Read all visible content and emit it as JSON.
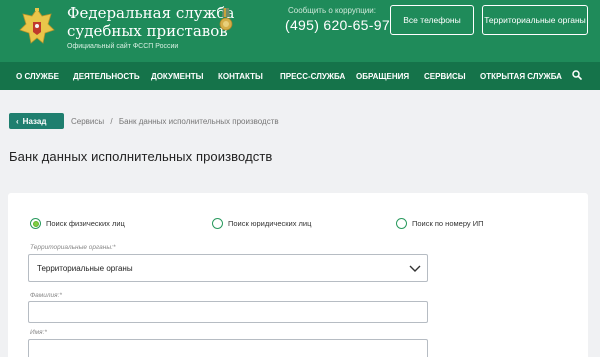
{
  "header": {
    "org_name_line1": "Федеральная служба",
    "org_name_line2": "судебных приставов",
    "org_sub": "Официальный сайт ФССП России",
    "corruption_label": "Сообщить о коррупции:",
    "corruption_phone": "(495) 620-65-97",
    "btn_phones": "Все телефоны",
    "btn_regions": "Территориальные органы"
  },
  "nav": {
    "items": [
      "О СЛУЖБЕ",
      "ДЕЯТЕЛЬНОСТЬ",
      "ДОКУМЕНТЫ",
      "КОНТАКТЫ",
      "ПРЕСС-СЛУЖБА",
      "ОБРАЩЕНИЯ",
      "СЕРВИСЫ",
      "ОТКРЫТАЯ СЛУЖБА"
    ],
    "search_icon": "search-icon"
  },
  "breadcrumb": {
    "back_label": "Назад",
    "items": [
      "Сервисы",
      "Банк данных исполнительных производств"
    ],
    "separator": "/"
  },
  "page": {
    "title": "Банк данных исполнительных производств"
  },
  "form": {
    "search_types": [
      {
        "label": "Поиск физических лиц",
        "selected": true
      },
      {
        "label": "Поиск юридических лиц",
        "selected": false
      },
      {
        "label": "Поиск по номеру ИП",
        "selected": false
      }
    ],
    "region_label": "Территориальные органы:*",
    "region_value": "Территориальные органы",
    "lastname_label": "Фамилия:*",
    "lastname_value": "",
    "firstname_label": "Имя:*",
    "firstname_value": ""
  },
  "colors": {
    "header_green": "#1f8b5a",
    "nav_green": "#15734a",
    "back_button": "#1f7f6f",
    "radio_selected": "#7fcf44"
  }
}
